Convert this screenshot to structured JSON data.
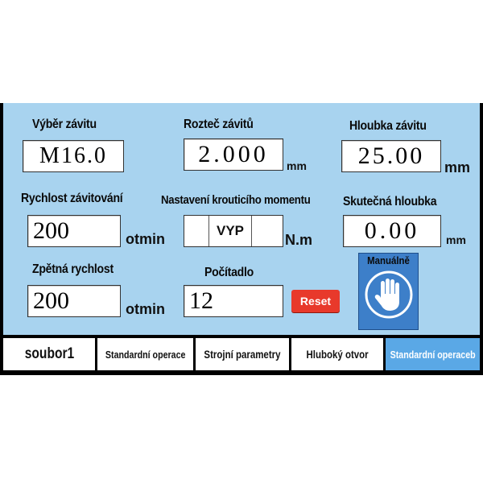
{
  "fields": {
    "thread_select": {
      "label": "Výběr závitu",
      "value": "M16.0"
    },
    "pitch": {
      "label": "Rozteč závitů",
      "value": "2.000",
      "unit": "mm"
    },
    "depth": {
      "label": "Hloubka závitu",
      "value": "25.00",
      "unit": "mm"
    },
    "tapping_speed": {
      "label": "Rychlost závitování",
      "value": "200",
      "unit": "otmin"
    },
    "torque": {
      "label": "Nastavení krouticího momentu",
      "value": "VYP",
      "unit": "N.m"
    },
    "actual_depth": {
      "label": "Skutečná hloubka",
      "value": "0.00",
      "unit": "mm"
    },
    "return_speed": {
      "label": "Zpětná rychlost",
      "value": "200",
      "unit": "otmin"
    },
    "counter": {
      "label": "Počítadlo",
      "value": "12"
    }
  },
  "buttons": {
    "reset": "Reset",
    "manual": "Manuálně"
  },
  "tabs": [
    {
      "label": "soubor1",
      "active": false
    },
    {
      "label": "Standardní operace",
      "active": false
    },
    {
      "label": "Strojní parametry",
      "active": false
    },
    {
      "label": "Hluboký otvor",
      "active": false
    },
    {
      "label": "Standardní operaceb",
      "active": true
    }
  ],
  "colors": {
    "panel_bg": "#a8d3ef",
    "reset_bg": "#e8392b",
    "manual_bg": "#3d7fc9",
    "active_tab": "#5aa8e6"
  },
  "icons": {
    "manual": "hand-icon"
  }
}
